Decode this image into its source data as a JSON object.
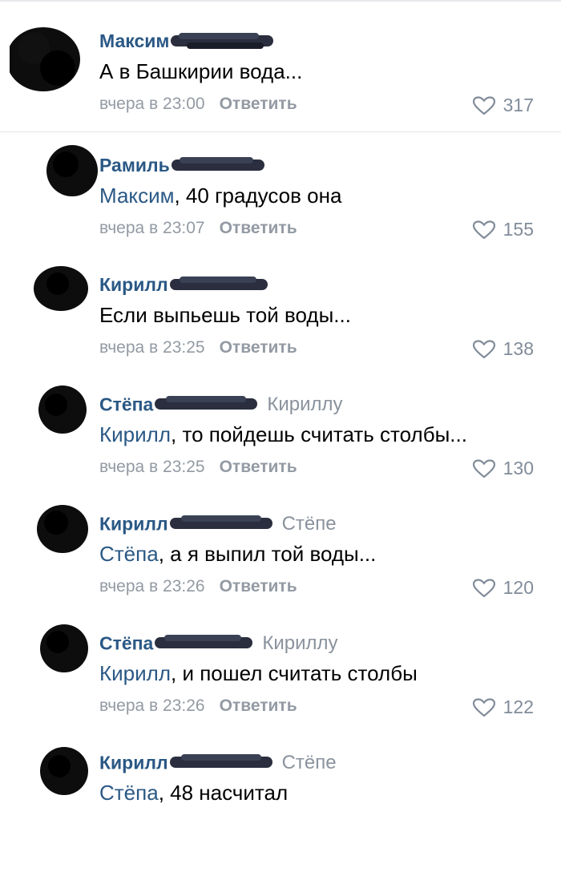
{
  "comments": [
    {
      "author": "Максим",
      "reply_to": "",
      "mention": "",
      "text": "А в Башкирии вода...",
      "time": "вчера в 23:00",
      "reply_label": "Ответить",
      "likes": "317"
    },
    {
      "author": "Рамиль",
      "reply_to": "",
      "mention": "Максим",
      "text": ", 40 градусов она",
      "time": "вчера в 23:07",
      "reply_label": "Ответить",
      "likes": "155"
    },
    {
      "author": "Кирилл",
      "reply_to": "",
      "mention": "",
      "text": "Если выпьешь той воды...",
      "time": "вчера в 23:25",
      "reply_label": "Ответить",
      "likes": "138"
    },
    {
      "author": "Стёпа",
      "reply_to": "Кириллу",
      "mention": "Кирилл",
      "text": ", то пойдешь считать столбы...",
      "time": "вчера в 23:25",
      "reply_label": "Ответить",
      "likes": "130"
    },
    {
      "author": "Кирилл",
      "reply_to": "Стёпе",
      "mention": "Стёпа",
      "text": ", а я выпил той воды...",
      "time": "вчера в 23:26",
      "reply_label": "Ответить",
      "likes": "120"
    },
    {
      "author": "Стёпа",
      "reply_to": "Кириллу",
      "mention": "Кирилл",
      "text": ", и пошел считать столбы",
      "time": "вчера в 23:26",
      "reply_label": "Ответить",
      "likes": "122"
    },
    {
      "author": "Кирилл",
      "reply_to": "Стёпе",
      "mention": "Стёпа",
      "text": ", 48 насчитал",
      "time": "",
      "reply_label": "",
      "likes": ""
    }
  ],
  "colors": {
    "link": "#2a5885",
    "meta": "#939aa3",
    "text": "#000000"
  },
  "icons": {
    "like": "heart-outline-icon",
    "avatar": "redacted-avatar"
  }
}
